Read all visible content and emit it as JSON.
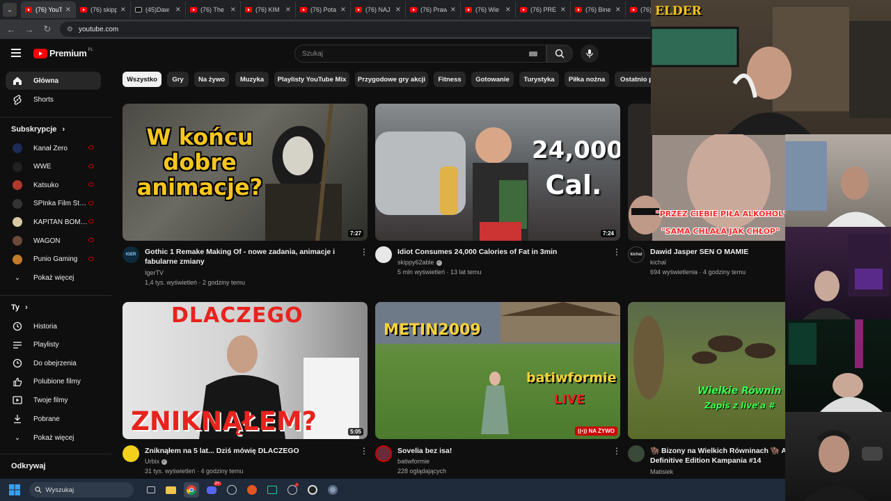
{
  "browser": {
    "tabs": [
      {
        "title": "(76) YouT",
        "icon": "youtube",
        "active": true
      },
      {
        "title": "(76) skipp",
        "icon": "youtube"
      },
      {
        "title": "(45)Daw",
        "icon": "tiktok"
      },
      {
        "title": "(76) The",
        "icon": "youtube"
      },
      {
        "title": "(76) KIM",
        "icon": "youtube"
      },
      {
        "title": "(76) Pota",
        "icon": "youtube"
      },
      {
        "title": "(76) NAJ",
        "icon": "youtube"
      },
      {
        "title": "(76) Praw",
        "icon": "youtube"
      },
      {
        "title": "(76) Wie",
        "icon": "youtube"
      },
      {
        "title": "(76) PRE",
        "icon": "youtube"
      },
      {
        "title": "(76) Bine",
        "icon": "youtube"
      },
      {
        "title": "(76)",
        "icon": "youtube"
      }
    ],
    "url": "youtube.com"
  },
  "masthead": {
    "logo_text": "Premium",
    "region": "PL",
    "search_placeholder": "Szukaj"
  },
  "sidebar": {
    "main": [
      {
        "label": "Główna",
        "icon": "home-icon",
        "active": true
      },
      {
        "label": "Shorts",
        "icon": "shorts-icon"
      }
    ],
    "subscriptions_heading": "Subskrypcje",
    "subscriptions": [
      {
        "label": "Kanał Zero",
        "avatar_color": "#1d2b5a"
      },
      {
        "label": "WWE",
        "avatar_color": "#222222"
      },
      {
        "label": "Katsuko",
        "avatar_color": "#b0392c"
      },
      {
        "label": "SPInka Film Stud...",
        "avatar_color": "#333333"
      },
      {
        "label": "KAPITAN BOMB...",
        "avatar_color": "#d9c9a3"
      },
      {
        "label": "WAGON",
        "avatar_color": "#6b4a3a"
      },
      {
        "label": "Punio Gaming",
        "avatar_color": "#c47a2c"
      }
    ],
    "show_more_1": "Pokaż więcej",
    "you_heading": "Ty",
    "you_items": [
      {
        "label": "Historia",
        "icon": "history-icon"
      },
      {
        "label": "Playlisty",
        "icon": "playlists-icon"
      },
      {
        "label": "Do obejrzenia",
        "icon": "watch-later-icon"
      },
      {
        "label": "Polubione filmy",
        "icon": "liked-icon"
      },
      {
        "label": "Twoje filmy",
        "icon": "your-videos-icon"
      },
      {
        "label": "Pobrane",
        "icon": "downloads-icon"
      }
    ],
    "show_more_2": "Pokaż więcej",
    "explore_heading": "Odkrywaj"
  },
  "chips": [
    "Wszystko",
    "Gry",
    "Na żywo",
    "Muzyka",
    "Playlisty YouTube Mix",
    "Przygodowe gry akcji",
    "Fitness",
    "Gotowanie",
    "Turystyka",
    "Piłka nożna",
    "Ostatnio p"
  ],
  "videos": [
    {
      "title_1": "Gothic 1 Remake  Making Of - nowe zadania, animacje i",
      "title_2": "fabularne zmiany",
      "channel": "IgerTV",
      "meta": "1,4 tys. wyświetleń · 2 godziny temu",
      "duration": "7:27",
      "overlay": [
        "W końcu",
        "dobre",
        "animacje?"
      ]
    },
    {
      "title_1": "Idiot Consumes 24,000 Calories of Fat in 3min",
      "title_2": "",
      "channel": "skippy62able",
      "meta": "5 mln wyświetleń · 13 lat temu",
      "duration": "7:24",
      "overlay": [
        "24,000",
        "Cal."
      ]
    },
    {
      "title_1": "Dawid Jasper SEN O MAMIE",
      "title_2": "",
      "channel": "kichal",
      "meta": "694 wyświetlenia · 4 godziny temu",
      "duration": "",
      "overlay": [
        "\"PRZEZ CIEBIE PIŁA ALKOHOL\"",
        "\"SAMA CHLAŁA JAK CHŁOP\""
      ]
    },
    {
      "title_1": "Zniknąłem na 5 lat... Dziś mówię DLACZEGO",
      "title_2": "",
      "channel": "Urbix",
      "meta": "31 tys. wyświetleń · 4 godziny temu",
      "duration": "5:05",
      "overlay": [
        "DLACZEGO",
        "ZNIKNĄŁEM?"
      ]
    },
    {
      "title_1": "Sovelia bez isa!",
      "title_2": "",
      "channel": "batiwformie",
      "meta": "228 oglądających",
      "duration": "NA ŻYWO",
      "overlay": [
        "METIN2009",
        "batiwformie",
        "LIVE"
      ]
    },
    {
      "title_1": "🦬 Bizony na Wielkich Równinach 🦬 Ag",
      "title_2": "Definitive Edition Kampania #14",
      "channel": "Matisiek",
      "meta": "",
      "duration": "",
      "overlay": [
        "Wielkie Równin",
        "Zapis z live'a #"
      ]
    }
  ],
  "stream": {
    "streamer_name": "ELDER"
  },
  "taskbar": {
    "search_placeholder": "Wyszukaj",
    "discord_badge": "2+"
  }
}
